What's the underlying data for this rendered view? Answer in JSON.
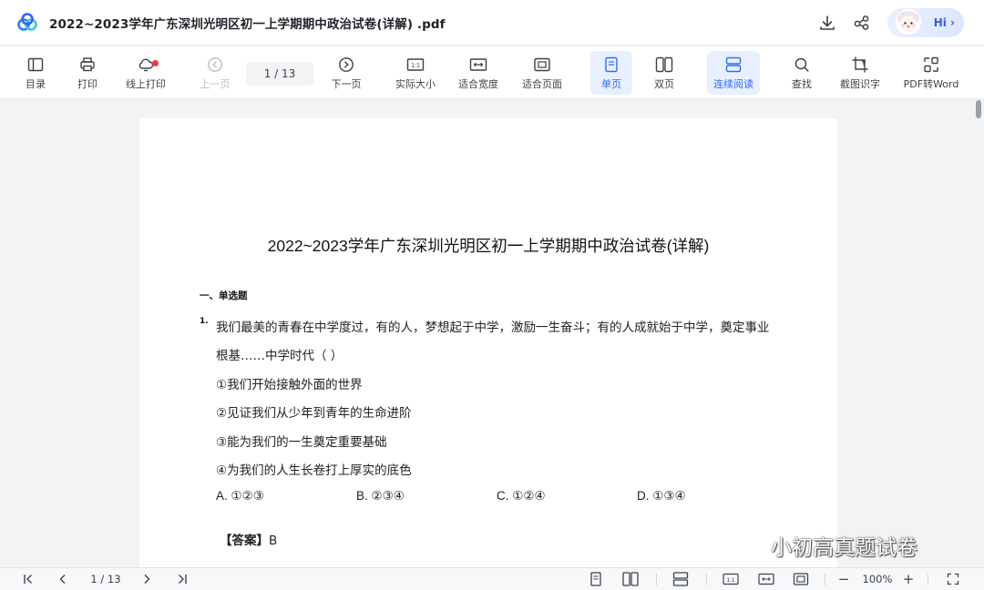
{
  "titlebar": {
    "doc_title": "2022~2023学年广东深圳光明区初一上学期期中政治试卷(详解) .pdf",
    "hi_label": "Hi ›"
  },
  "toolbar": {
    "items": [
      {
        "label": "目录",
        "icon": "sidebar-toggle-icon"
      },
      {
        "label": "打印",
        "icon": "printer-icon"
      },
      {
        "label": "线上打印",
        "icon": "cloud-print-icon"
      },
      {
        "label": "上一页",
        "icon": "previous-page-icon"
      },
      {
        "label": "下一页",
        "icon": "next-page-icon"
      },
      {
        "label": "实际大小",
        "icon": "actual-size-icon"
      },
      {
        "label": "适合宽度",
        "icon": "fit-width-icon"
      },
      {
        "label": "适合页面",
        "icon": "fit-page-icon"
      },
      {
        "label": "单页",
        "icon": "single-page-icon"
      },
      {
        "label": "双页",
        "icon": "double-page-icon"
      },
      {
        "label": "连续阅读",
        "icon": "continuous-read-icon"
      },
      {
        "label": "查找",
        "icon": "search-icon"
      },
      {
        "label": "截图识字",
        "icon": "screenshot-ocr-icon"
      },
      {
        "label": "PDF转Word",
        "icon": "pdf-to-word-icon"
      }
    ],
    "page_indicator": "1  / 13",
    "actual_size_glyph": "1:1"
  },
  "document": {
    "title": "2022~2023学年广东深圳光明区初一上学期期中政治试卷(详解)",
    "section_heading": "一、单选题",
    "question_number": "1.",
    "question_lines": [
      "我们最美的青春在中学度过，有的人，梦想起于中学，激励一生奋斗；有的人成就始于中学，奠定事业",
      "根基……中学时代（    ）",
      "①我们开始接触外面的世界",
      "②见证我们从少年到青年的生命进阶",
      "③能为我们的一生奠定重要基础",
      "④为我们的人生长卷打上厚实的底色"
    ],
    "options": [
      "A. ①②③",
      "B. ②③④",
      "C. ①②④",
      "D. ①③④"
    ],
    "answer_label": "【答案】",
    "answer_value": "B"
  },
  "watermark": {
    "text": "小初高真题试卷"
  },
  "bottombar": {
    "page_indicator": "1  / 13",
    "zoom": "100%",
    "zoom_out": "−",
    "zoom_in": "+",
    "actual_size_glyph": "1:1"
  },
  "colors": {
    "accent": "#2e6cf6",
    "active_bg": "#e8f0ff",
    "notify_dot": "#f5364c"
  }
}
